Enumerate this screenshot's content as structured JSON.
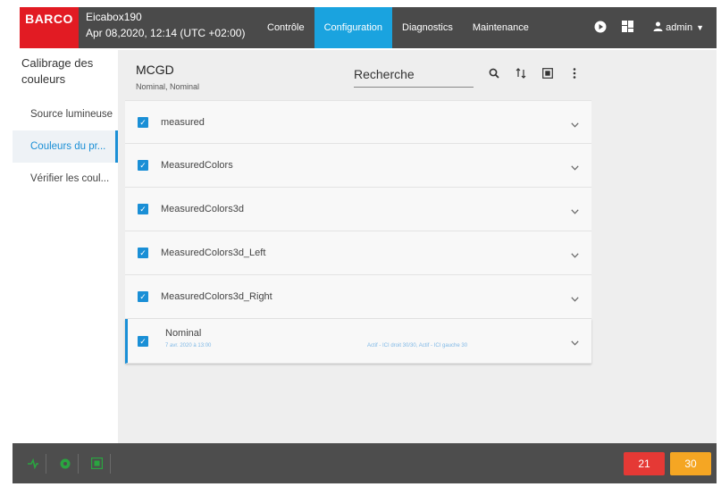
{
  "colors": {
    "brand": "#e21b23",
    "accent": "#1aa3df",
    "topbar": "#4a4a4a",
    "error": "#e53935",
    "warning": "#f5a623",
    "ok": "#2aa540"
  },
  "header": {
    "brand": "BARCO",
    "device_name": "Eicabox190",
    "datetime": "Apr 08,2020, 12:14 (UTC +02:00)",
    "tabs": [
      {
        "label": "Contrôle",
        "active": false
      },
      {
        "label": "Configuration",
        "active": true
      },
      {
        "label": "Diagnostics",
        "active": false
      },
      {
        "label": "Maintenance",
        "active": false
      }
    ],
    "icons": [
      "play-icon",
      "grid-icon"
    ],
    "user": "admin"
  },
  "sidebar": {
    "title": "Calibrage des couleurs",
    "items": [
      {
        "label": "Source lumineuse",
        "active": false
      },
      {
        "label": "Couleurs du pr...",
        "active": true
      },
      {
        "label": "Vérifier les coul...",
        "active": false
      }
    ]
  },
  "panel": {
    "title": "MCGD",
    "subtitle": "Nominal, Nominal",
    "search_placeholder": "Recherche",
    "icons": [
      "search-icon",
      "sort-icon",
      "fit-screen-icon",
      "more-vert-icon"
    ]
  },
  "list": {
    "items": [
      {
        "label": "measured",
        "checked": true
      },
      {
        "label": "MeasuredColors",
        "checked": true
      },
      {
        "label": "MeasuredColors3d",
        "checked": true
      },
      {
        "label": "MeasuredColors3d_Left",
        "checked": true
      },
      {
        "label": "MeasuredColors3d_Right",
        "checked": true
      }
    ],
    "selected": {
      "label": "Nominal",
      "checked": true,
      "date": "7 avr. 2020 à 13:00",
      "detail": "Actif - ICI droit 30/30, Actif - ICI gauche 30"
    }
  },
  "footer": {
    "icons": [
      "signal-icon",
      "gear-status-icon",
      "projector-icon"
    ],
    "badges": [
      {
        "value": "21",
        "color": "red"
      },
      {
        "value": "30",
        "color": "orange"
      }
    ]
  }
}
